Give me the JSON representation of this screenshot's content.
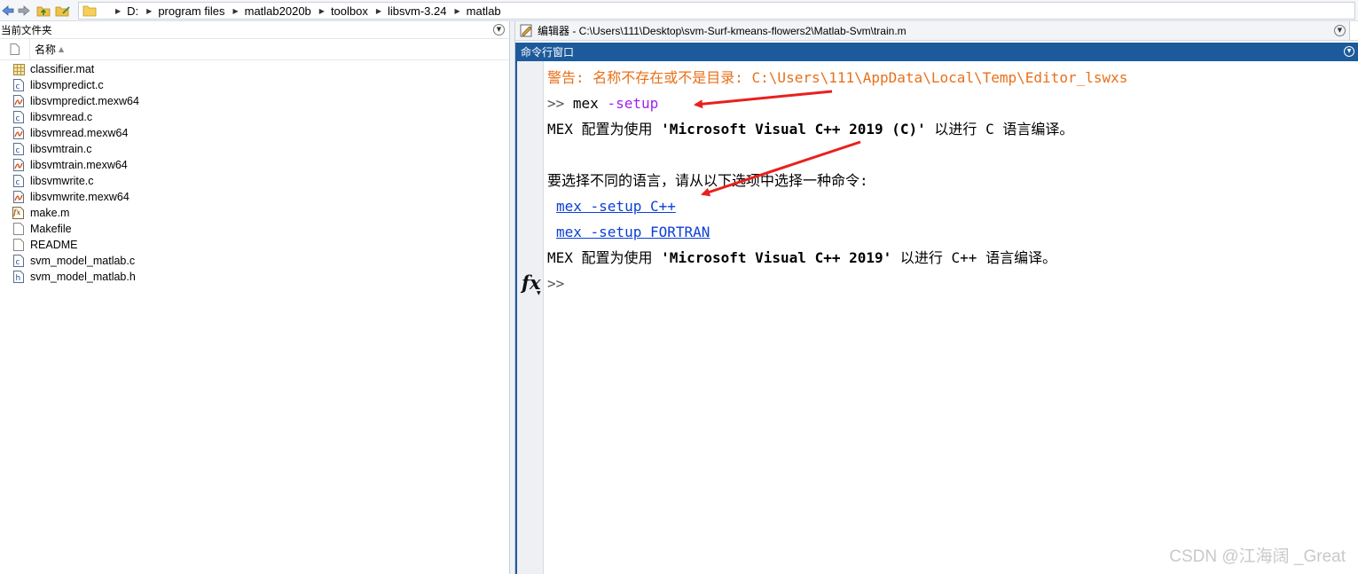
{
  "address_bar": {
    "crumbs": [
      "D:",
      "program files",
      "matlab2020b",
      "toolbox",
      "libsvm-3.24",
      "matlab"
    ]
  },
  "left_panel": {
    "title": "当前文件夹",
    "column_name": "名称",
    "files": [
      {
        "name": "classifier.mat",
        "icon": "mat-file-icon"
      },
      {
        "name": "libsvmpredict.c",
        "icon": "c-file-icon"
      },
      {
        "name": "libsvmpredict.mexw64",
        "icon": "mex-file-icon"
      },
      {
        "name": "libsvmread.c",
        "icon": "c-file-icon"
      },
      {
        "name": "libsvmread.mexw64",
        "icon": "mex-file-icon"
      },
      {
        "name": "libsvmtrain.c",
        "icon": "c-file-icon"
      },
      {
        "name": "libsvmtrain.mexw64",
        "icon": "mex-file-icon"
      },
      {
        "name": "libsvmwrite.c",
        "icon": "c-file-icon"
      },
      {
        "name": "libsvmwrite.mexw64",
        "icon": "mex-file-icon"
      },
      {
        "name": "make.m",
        "icon": "m-file-icon"
      },
      {
        "name": "Makefile",
        "icon": "plain-file-icon"
      },
      {
        "name": "README",
        "icon": "plain-file-icon"
      },
      {
        "name": "svm_model_matlab.c",
        "icon": "c-file-icon"
      },
      {
        "name": "svm_model_matlab.h",
        "icon": "h-file-icon"
      }
    ]
  },
  "editor": {
    "title": "编辑器 - C:\\Users\\111\\Desktop\\svm-Surf-kmeans-flowers2\\Matlab-Svm\\train.m"
  },
  "command_window": {
    "title": "命令行窗口",
    "warning": "警告: 名称不存在或不是目录: C:\\Users\\111\\AppData\\Local\\Temp\\Editor_lswxs",
    "prompt": ">>",
    "cmd_text": "mex",
    "cmd_arg": "-setup",
    "line3_a": "MEX 配置为使用 ",
    "line3_b": "'Microsoft Visual C++ 2019 (C)'",
    "line3_c": " 以进行 C 语言编译。",
    "choose_text": "要选择不同的语言，请从以下选项中选择一种命令:",
    "link1": "mex -setup C++",
    "link2": "mex -setup FORTRAN",
    "line6_a": "MEX 配置为使用 ",
    "line6_b": "'Microsoft Visual C++ 2019'",
    "line6_c": " 以进行 C++ 语言编译。",
    "fx": "fx",
    "final_prompt": ">>"
  },
  "watermark": "CSDN @江海阔 _Great",
  "colors": {
    "warning": "#e8701a",
    "keyword": "#a020f0",
    "link": "#0b3ed6",
    "title_bar": "#1d5a9c",
    "arrow": "#e8201e"
  }
}
